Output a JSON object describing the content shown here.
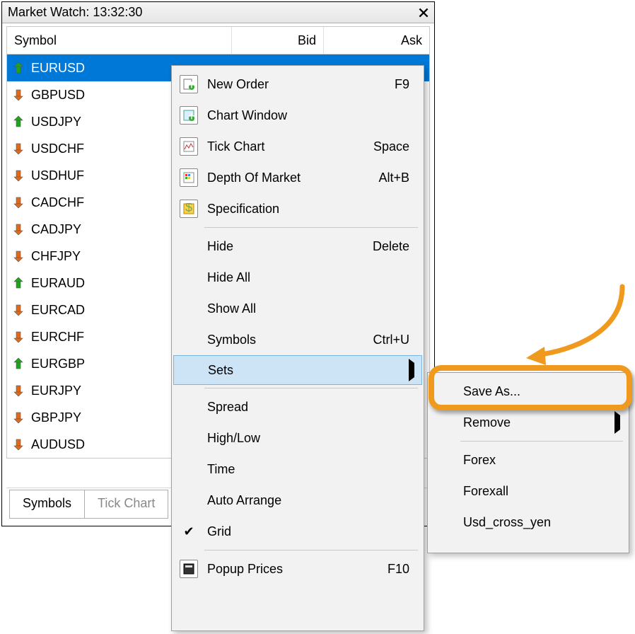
{
  "panel": {
    "title": "Market Watch: 13:32:30",
    "headers": {
      "symbol": "Symbol",
      "bid": "Bid",
      "ask": "Ask"
    },
    "rows": [
      {
        "symbol": "EURUSD",
        "dir": "up",
        "selected": true
      },
      {
        "symbol": "GBPUSD",
        "dir": "down",
        "selected": false
      },
      {
        "symbol": "USDJPY",
        "dir": "up",
        "selected": false
      },
      {
        "symbol": "USDCHF",
        "dir": "down",
        "selected": false
      },
      {
        "symbol": "USDHUF",
        "dir": "down",
        "selected": false
      },
      {
        "symbol": "CADCHF",
        "dir": "down",
        "selected": false
      },
      {
        "symbol": "CADJPY",
        "dir": "down",
        "selected": false
      },
      {
        "symbol": "CHFJPY",
        "dir": "down",
        "selected": false
      },
      {
        "symbol": "EURAUD",
        "dir": "up",
        "selected": false
      },
      {
        "symbol": "EURCAD",
        "dir": "down",
        "selected": false
      },
      {
        "symbol": "EURCHF",
        "dir": "down",
        "selected": false
      },
      {
        "symbol": "EURGBP",
        "dir": "up",
        "selected": false
      },
      {
        "symbol": "EURJPY",
        "dir": "down",
        "selected": false
      },
      {
        "symbol": "GBPJPY",
        "dir": "down",
        "selected": false
      },
      {
        "symbol": "AUDUSD",
        "dir": "down",
        "selected": false
      }
    ],
    "tabs": {
      "symbols": "Symbols",
      "tick": "Tick Chart"
    }
  },
  "context_menu": {
    "items": [
      {
        "icon": "new-order-icon",
        "label": "New Order",
        "shortcut": "F9"
      },
      {
        "icon": "chart-window-icon",
        "label": "Chart Window",
        "shortcut": ""
      },
      {
        "icon": "tick-chart-icon",
        "label": "Tick Chart",
        "shortcut": "Space"
      },
      {
        "icon": "depth-icon",
        "label": "Depth Of Market",
        "shortcut": "Alt+B"
      },
      {
        "icon": "spec-icon",
        "label": "Specification",
        "shortcut": ""
      }
    ],
    "group2": [
      {
        "label": "Hide",
        "shortcut": "Delete"
      },
      {
        "label": "Hide All",
        "shortcut": ""
      },
      {
        "label": "Show All",
        "shortcut": ""
      },
      {
        "label": "Symbols",
        "shortcut": "Ctrl+U"
      },
      {
        "label": "Sets",
        "shortcut": "",
        "submenu": true,
        "hover": true
      }
    ],
    "group3": [
      {
        "label": "Spread"
      },
      {
        "label": "High/Low"
      },
      {
        "label": "Time"
      },
      {
        "label": "Auto Arrange"
      },
      {
        "label": "Grid",
        "checked": true
      }
    ],
    "group4": [
      {
        "icon": "popup-icon",
        "label": "Popup Prices",
        "shortcut": "F10"
      }
    ]
  },
  "sets_submenu": {
    "items": [
      {
        "label": "Save As..."
      },
      {
        "label": "Remove",
        "submenu": true
      }
    ],
    "presets": [
      {
        "label": "Forex"
      },
      {
        "label": "Forexall"
      },
      {
        "label": "Usd_cross_yen"
      }
    ]
  }
}
